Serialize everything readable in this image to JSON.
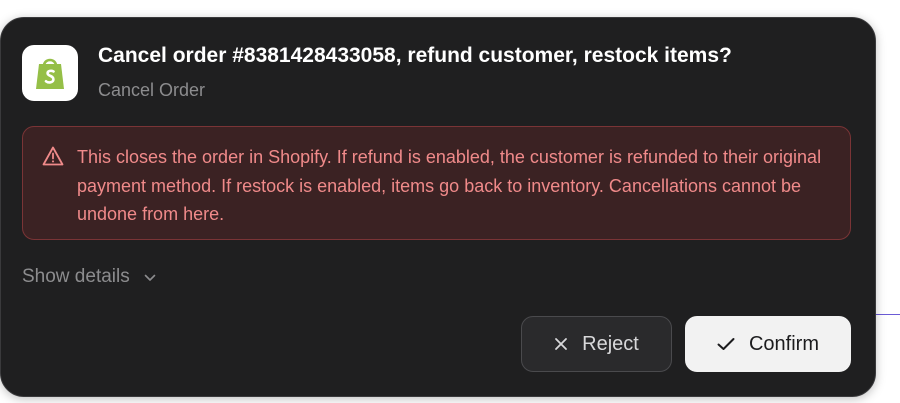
{
  "dialog": {
    "title": "Cancel order #8381428433058, refund customer, restock items?",
    "subtitle": "Cancel Order",
    "app_icon": "shopify-bag-icon",
    "warning": {
      "icon": "warning-triangle-icon",
      "text": "This closes the order in Shopify. If refund is enabled, the customer is refunded to their original payment method. If restock is enabled, items go back to inventory. Cancellations cannot be undone from here."
    },
    "show_details": {
      "label": "Show details",
      "icon": "chevron-down-icon"
    },
    "buttons": {
      "reject_label": "Reject",
      "reject_icon": "close-icon",
      "confirm_label": "Confirm",
      "confirm_icon": "check-icon"
    }
  },
  "colors": {
    "dialog_bg": "#1f1f20",
    "warning_bg": "#3b2223",
    "warning_border": "#7a3436",
    "warning_text": "#f08a8a",
    "shopify_green": "#95bf47",
    "confirm_bg": "#f2f2f2"
  }
}
